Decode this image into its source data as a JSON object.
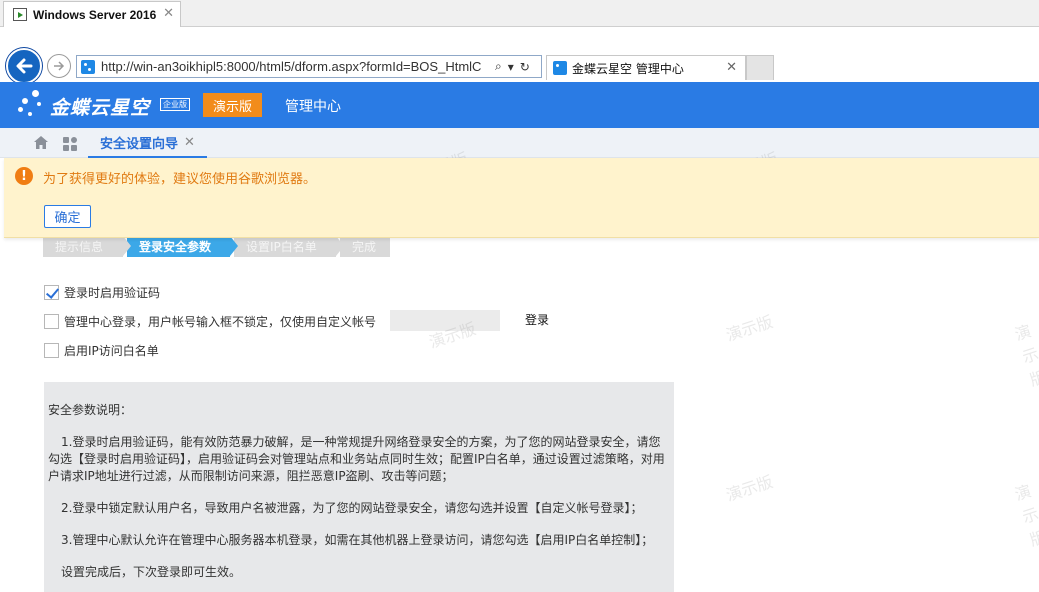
{
  "vm_tab": {
    "title": "Windows Server 2016",
    "close": "✕"
  },
  "browser": {
    "url": "http://win-an3oikhipl5:8000/html5/dform.aspx?formId=BOS_HtmlC",
    "search_glyph": "⌕",
    "dropdown_glyph": "▾",
    "refresh_glyph": "↻",
    "tab_title": "金蝶云星空 管理中心",
    "tab_close": "✕"
  },
  "header": {
    "logo_text": "金蝶云星空",
    "logo_badge": "企业版",
    "demo_label": "演示版",
    "title": "管理中心"
  },
  "tabs": {
    "active_label": "安全设置向导",
    "close": "✕"
  },
  "warning": {
    "icon": "!",
    "message": "为了获得更好的体验，建议您使用谷歌浏览器。",
    "ok_label": "确定"
  },
  "steps": [
    "提示信息",
    "登录安全参数",
    "设置IP白名单",
    "完成"
  ],
  "options": {
    "captcha": "登录时启用验证码",
    "custom_account": "管理中心登录，用户帐号输入框不锁定，仅使用自定义帐号",
    "ip_whitelist": "启用IP访问白名单"
  },
  "login_label": "登录",
  "info": {
    "heading": "安全参数说明：",
    "p1": "1.登录时启用验证码，能有效防范暴力破解，是一种常规提升网络登录安全的方案，为了您的网站登录安全，请您勾选【登录时启用验证码】，启用验证码会对管理站点和业务站点同时生效；配置IP白名单，通过设置过滤策略，对用户请求IP地址进行过滤，从而限制访问来源，阻拦恶意IP盗刷、攻击等问题；",
    "p2": "2.登录中锁定默认用户名，导致用户名被泄露，为了您的网站登录安全，请您勾选并设置【自定义帐号登录】；",
    "p3": "3.管理中心默认允许在管理中心服务器本机登录，如需在其他机器上登录访问，请您勾选【启用IP白名单控制】；",
    "p4": "设置完成后，下次登录即可生效。"
  },
  "watermark": "演示版",
  "colors": {
    "brand_blue": "#2a7be4",
    "demo_orange": "#f28c1b",
    "warn_bg": "#fff3cd",
    "step_active": "#3ca8e8"
  }
}
